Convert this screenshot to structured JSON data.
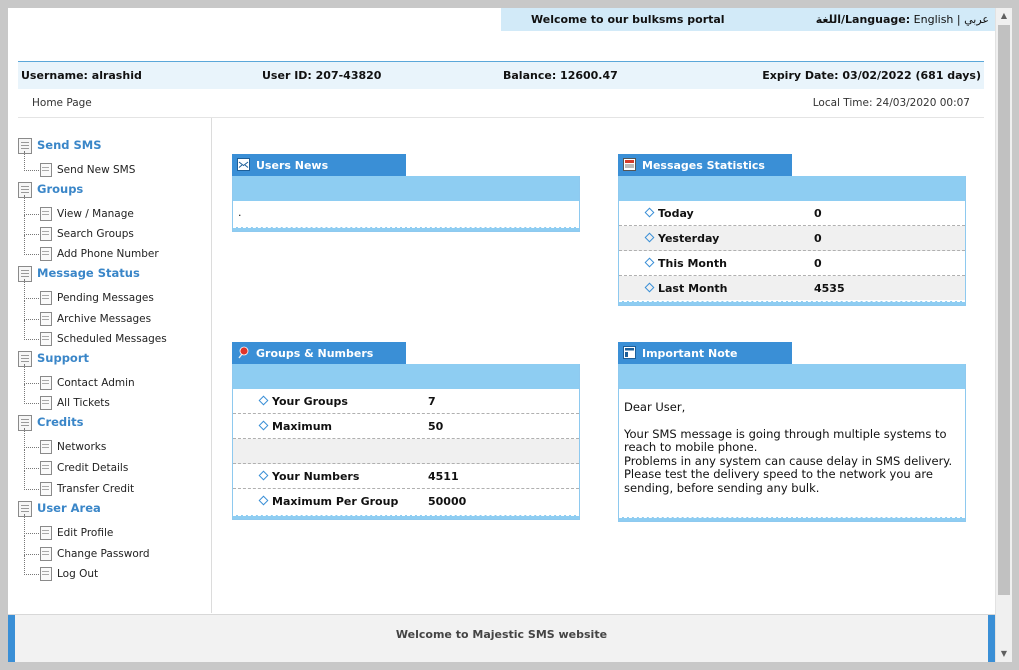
{
  "welcome": {
    "text": "Welcome to our bulksms portal"
  },
  "language": {
    "label": "اللغة/Language:",
    "english": "English",
    "separator": "|",
    "arabic": "عربي"
  },
  "user_bar": {
    "username": "Username: alrashid",
    "user_id": "User ID: 207-43820",
    "balance": "Balance: 12600.47",
    "expiry": "Expiry Date: 03/02/2022 (681 days)"
  },
  "breadcrumb": {
    "home": "Home Page"
  },
  "local_time": "Local Time: 24/03/2020 00:07",
  "sidebar": {
    "sections": [
      {
        "title": "Send SMS",
        "items": [
          "Send New SMS"
        ]
      },
      {
        "title": "Groups",
        "items": [
          "View / Manage",
          "Search Groups",
          "Add Phone Number"
        ]
      },
      {
        "title": "Message Status",
        "items": [
          "Pending Messages",
          "Archive Messages",
          "Scheduled Messages"
        ]
      },
      {
        "title": "Support",
        "items": [
          "Contact Admin",
          "All Tickets"
        ]
      },
      {
        "title": "Credits",
        "items": [
          "Networks",
          "Credit Details",
          "Transfer Credit"
        ]
      },
      {
        "title": "User Area",
        "items": [
          "Edit Profile",
          "Change Password",
          "Log Out"
        ]
      }
    ]
  },
  "users_news": {
    "title": "Users News",
    "content": "."
  },
  "messages_statistics": {
    "title": "Messages Statistics",
    "rows": [
      {
        "label": "Today",
        "value": "0"
      },
      {
        "label": "Yesterday",
        "value": "0"
      },
      {
        "label": "This Month",
        "value": "0"
      },
      {
        "label": "Last Month",
        "value": "4535"
      }
    ]
  },
  "groups_numbers": {
    "title": "Groups & Numbers",
    "rows": [
      {
        "label": "Your Groups",
        "value": "7"
      },
      {
        "label": "Maximum",
        "value": "50"
      },
      {
        "label": "Your Numbers",
        "value": "4511"
      },
      {
        "label": "Maximum Per Group",
        "value": "50000"
      }
    ]
  },
  "important_note": {
    "title": "Important Note",
    "greeting": "Dear User,",
    "lines": [
      "Your SMS message is going through multiple systems to reach to mobile phone.",
      "Problems in any system can cause delay in SMS delivery.",
      "Please test the delivery speed to the network you are sending, before sending any bulk."
    ]
  },
  "footer": {
    "text": "Welcome to Majestic SMS website"
  },
  "colors": {
    "accent": "#3a8fd6",
    "header_fill": "#8ecdf2",
    "link": "#3a86c8"
  }
}
